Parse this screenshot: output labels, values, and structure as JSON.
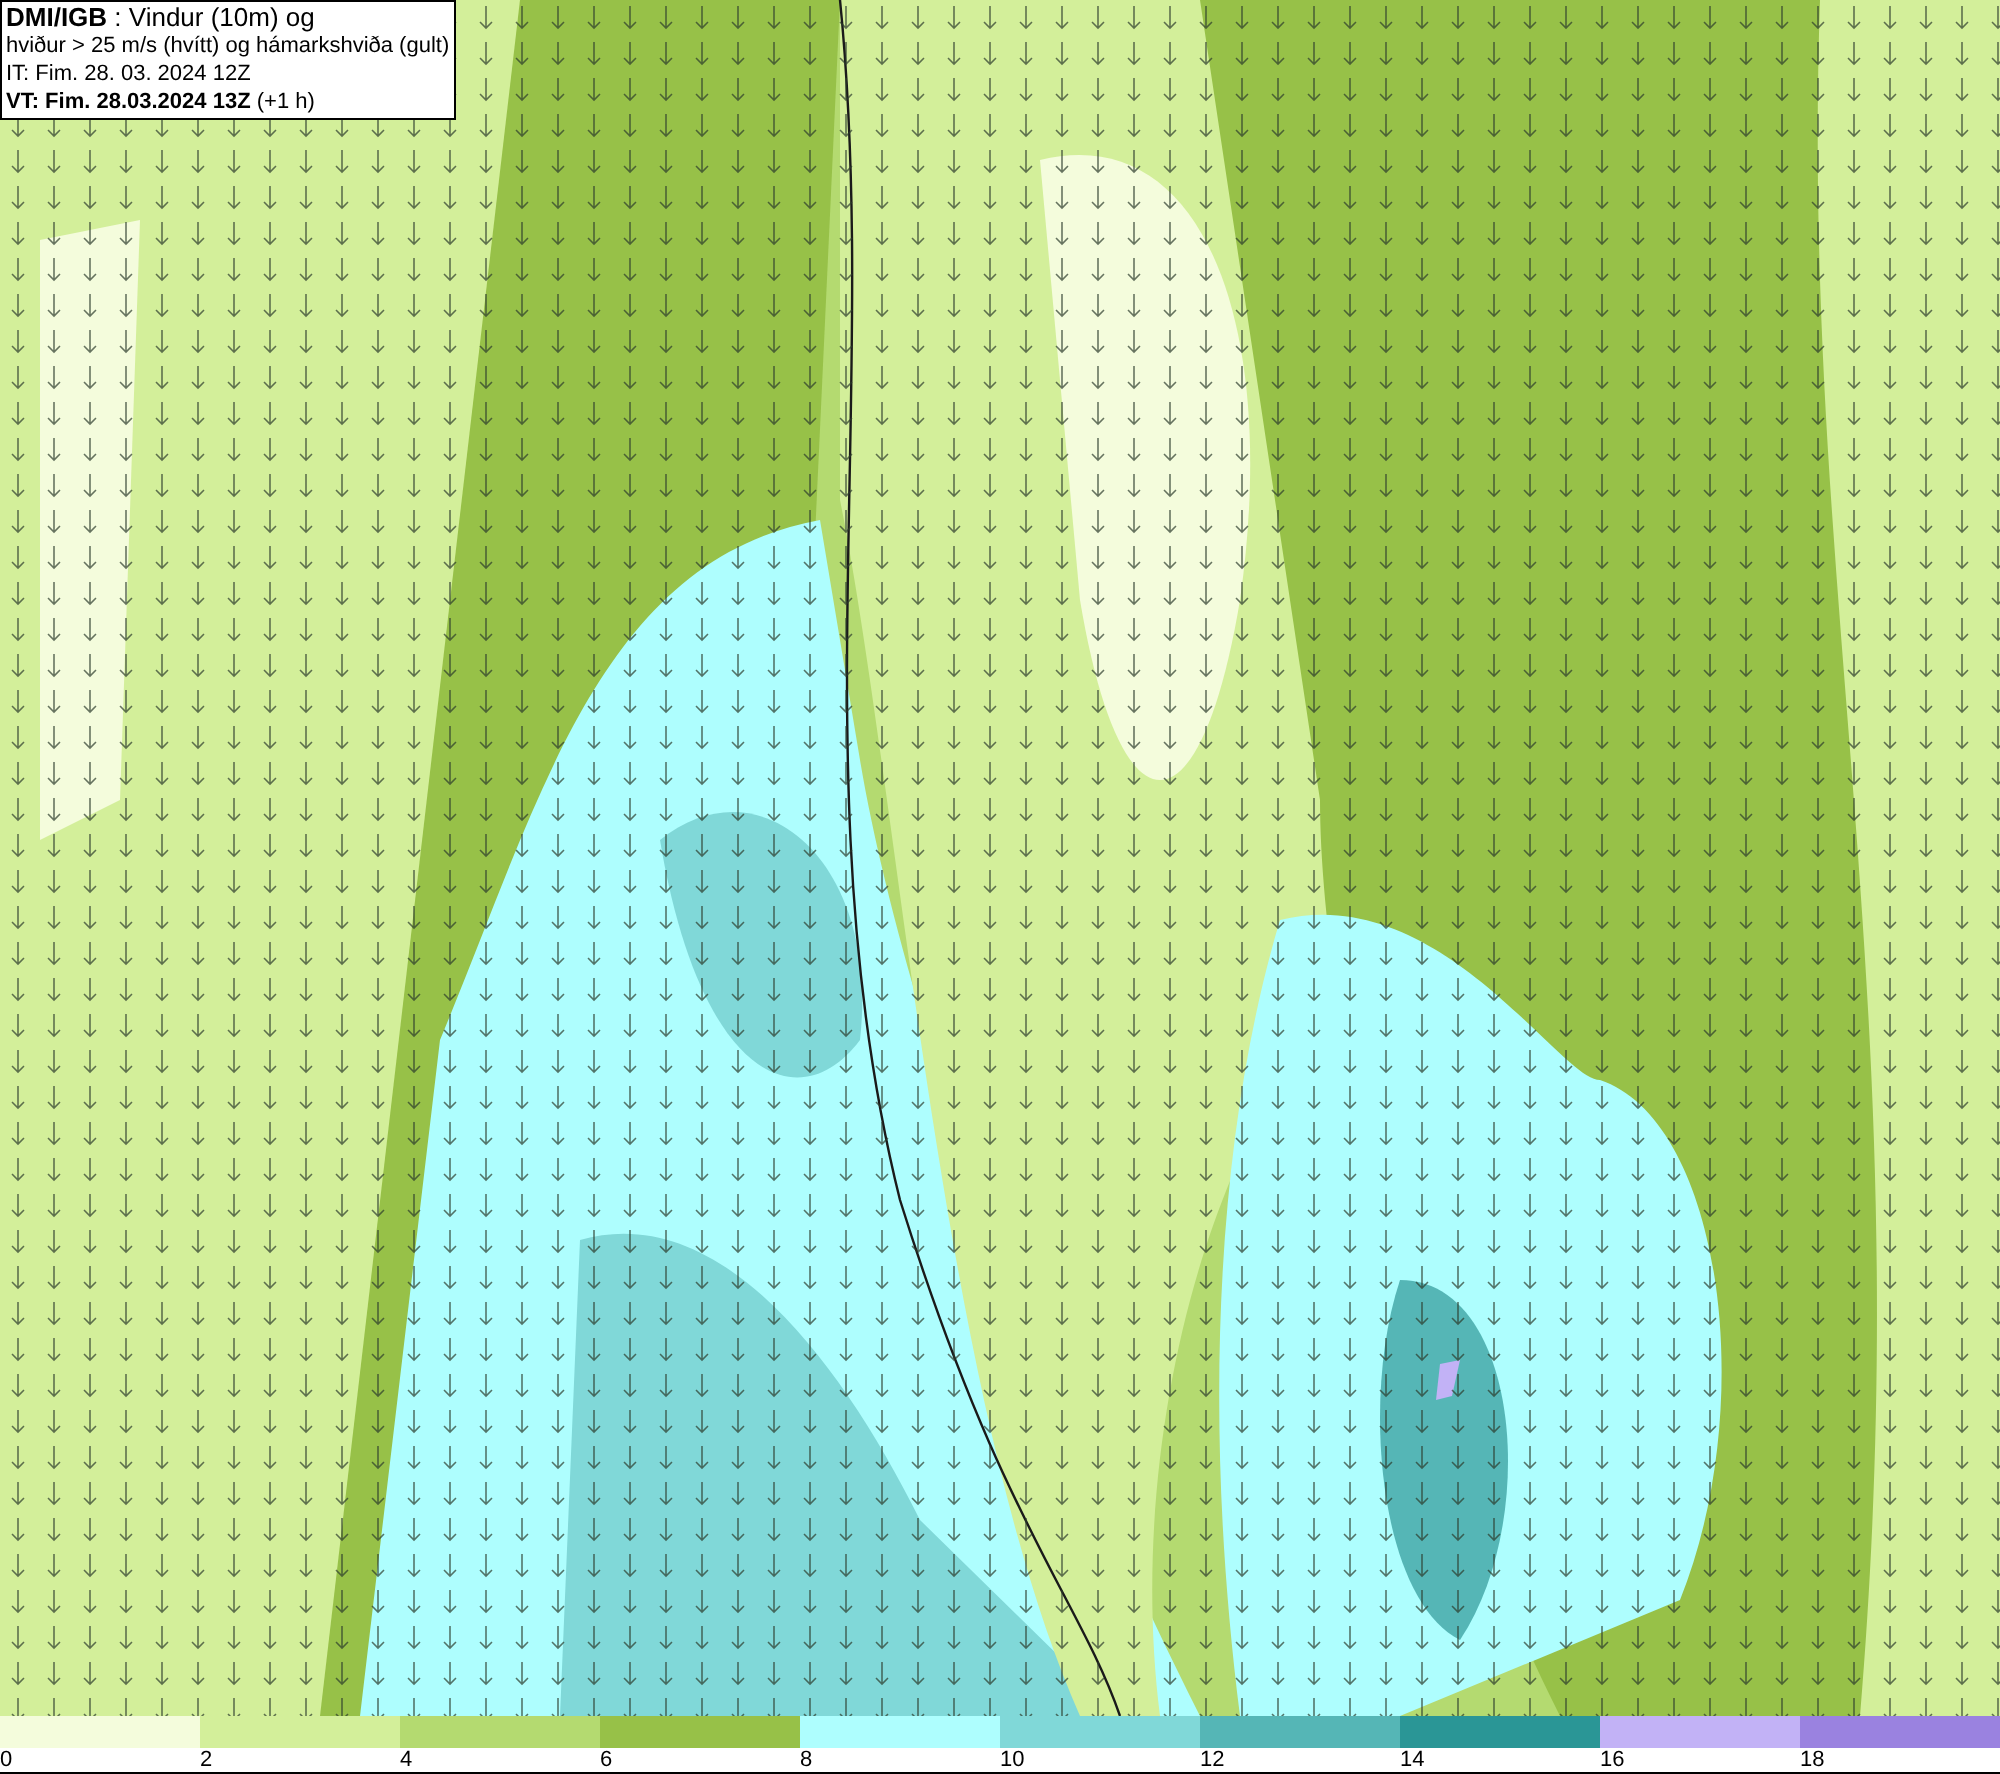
{
  "title_box": {
    "lines": [
      "**DMI/IGB** : Vindur (10m) og",
      "hviður > 25 m/s (hvítt) og hámarkshviða (gult)",
      "IT: Fim. 28. 03. 2024 12Z",
      "**VT: Fim. 28.03.2024 13Z** (+1 h)"
    ]
  },
  "legend": {
    "bins": [
      {
        "color": "#f4fcdc"
      },
      {
        "color": "#d3ef9a"
      },
      {
        "color": "#b4da70"
      },
      {
        "color": "#97c148"
      },
      {
        "color": "#aefefe"
      },
      {
        "color": "#80d8d8"
      },
      {
        "color": "#55b6b6"
      },
      {
        "color": "#2a9696"
      },
      {
        "color": "#c2b2f6"
      },
      {
        "color": "#9a82e0"
      }
    ],
    "labels": [
      "0",
      "2",
      "4",
      "6",
      "8",
      "10",
      "12",
      "14",
      "16",
      "18"
    ]
  }
}
